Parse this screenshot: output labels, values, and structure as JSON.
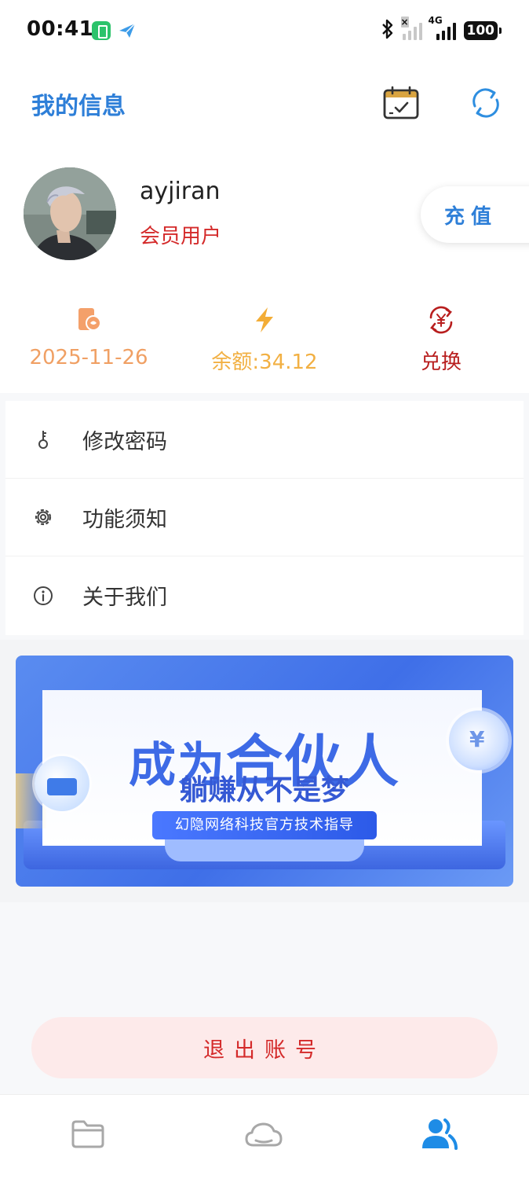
{
  "status_bar": {
    "time": "00:41",
    "battery": "100",
    "network": "4G"
  },
  "header": {
    "title": "我的信息",
    "icons": [
      "calendar-check-icon",
      "refresh-icon"
    ]
  },
  "profile": {
    "username": "ayjiran",
    "member_type": "会员用户",
    "recharge_label": "充值"
  },
  "stats": {
    "expire_date": "2025-11-26",
    "balance": "余额:34.12",
    "exchange_label": "兑换",
    "icons": [
      "expire-phone-icon",
      "lightning-icon",
      "exchange-yuan-icon"
    ]
  },
  "menu": {
    "items": [
      {
        "label": "修改密码",
        "icon": "key-icon"
      },
      {
        "label": "功能须知",
        "icon": "gear-icon"
      },
      {
        "label": "关于我们",
        "icon": "info-icon"
      }
    ]
  },
  "banner": {
    "title_prefix": "成为",
    "title_main": "合伙人",
    "subtitle": "躺赚从不是梦",
    "tag": "幻隐网络科技官方技术指导"
  },
  "logout_label": "退出账号",
  "bottom_nav": {
    "items": [
      "folder-icon",
      "cloud-icon",
      "users-icon"
    ],
    "active_color": "#1e8ce6"
  },
  "colors": {
    "accent": "#2e7fd8",
    "danger": "#d42a2a",
    "expire": "#f0a064",
    "balance": "#f2b043"
  }
}
